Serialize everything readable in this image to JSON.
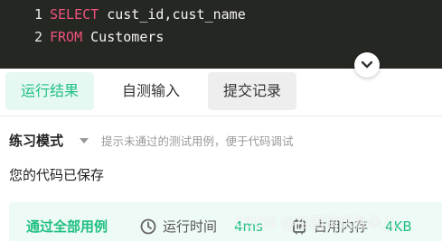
{
  "editor": {
    "lines": [
      {
        "number": "1",
        "keyword": "SELECT",
        "rest": " cust_id,cust_name"
      },
      {
        "number": "2",
        "keyword": "FROM",
        "rest": " Customers"
      }
    ],
    "collapse_icon": "chevron-down-icon",
    "background_color": "#252722",
    "keyword_color": "#f0527c"
  },
  "tabs": [
    {
      "label": "运行结果",
      "active": true
    },
    {
      "label": "自测输入",
      "active": false
    },
    {
      "label": "提交记录",
      "active": false
    }
  ],
  "mode": {
    "title": "练习模式",
    "hint": "提示未通过的测试用例，便于代码调试"
  },
  "status": {
    "saved_message": "您的代码已保存"
  },
  "result": {
    "pass_text": "通过全部用例",
    "runtime_label": "运行时间",
    "runtime_value": "4ms",
    "memory_label": "占用内存",
    "memory_value": "4KB",
    "accent_color": "#1fbf82"
  },
  "watermark": "CSDN @祖国滴花骨朵儿"
}
